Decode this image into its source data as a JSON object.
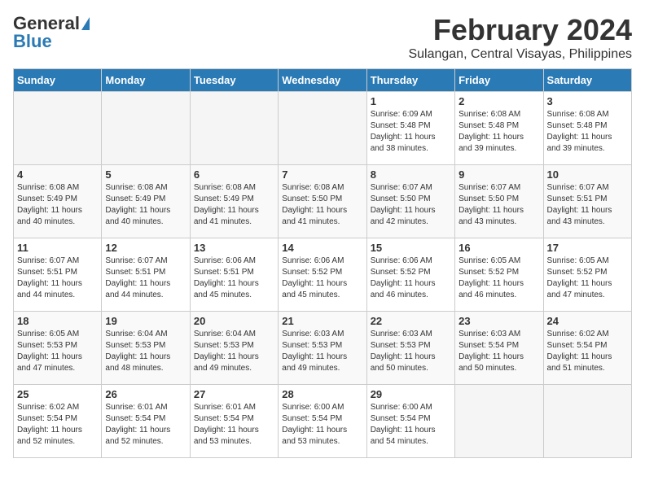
{
  "logo": {
    "general": "General",
    "blue": "Blue"
  },
  "title": "February 2024",
  "subtitle": "Sulangan, Central Visayas, Philippines",
  "days_of_week": [
    "Sunday",
    "Monday",
    "Tuesday",
    "Wednesday",
    "Thursday",
    "Friday",
    "Saturday"
  ],
  "weeks": [
    [
      {
        "day": "",
        "info": ""
      },
      {
        "day": "",
        "info": ""
      },
      {
        "day": "",
        "info": ""
      },
      {
        "day": "",
        "info": ""
      },
      {
        "day": "1",
        "info": "Sunrise: 6:09 AM\nSunset: 5:48 PM\nDaylight: 11 hours\nand 38 minutes."
      },
      {
        "day": "2",
        "info": "Sunrise: 6:08 AM\nSunset: 5:48 PM\nDaylight: 11 hours\nand 39 minutes."
      },
      {
        "day": "3",
        "info": "Sunrise: 6:08 AM\nSunset: 5:48 PM\nDaylight: 11 hours\nand 39 minutes."
      }
    ],
    [
      {
        "day": "4",
        "info": "Sunrise: 6:08 AM\nSunset: 5:49 PM\nDaylight: 11 hours\nand 40 minutes."
      },
      {
        "day": "5",
        "info": "Sunrise: 6:08 AM\nSunset: 5:49 PM\nDaylight: 11 hours\nand 40 minutes."
      },
      {
        "day": "6",
        "info": "Sunrise: 6:08 AM\nSunset: 5:49 PM\nDaylight: 11 hours\nand 41 minutes."
      },
      {
        "day": "7",
        "info": "Sunrise: 6:08 AM\nSunset: 5:50 PM\nDaylight: 11 hours\nand 41 minutes."
      },
      {
        "day": "8",
        "info": "Sunrise: 6:07 AM\nSunset: 5:50 PM\nDaylight: 11 hours\nand 42 minutes."
      },
      {
        "day": "9",
        "info": "Sunrise: 6:07 AM\nSunset: 5:50 PM\nDaylight: 11 hours\nand 43 minutes."
      },
      {
        "day": "10",
        "info": "Sunrise: 6:07 AM\nSunset: 5:51 PM\nDaylight: 11 hours\nand 43 minutes."
      }
    ],
    [
      {
        "day": "11",
        "info": "Sunrise: 6:07 AM\nSunset: 5:51 PM\nDaylight: 11 hours\nand 44 minutes."
      },
      {
        "day": "12",
        "info": "Sunrise: 6:07 AM\nSunset: 5:51 PM\nDaylight: 11 hours\nand 44 minutes."
      },
      {
        "day": "13",
        "info": "Sunrise: 6:06 AM\nSunset: 5:51 PM\nDaylight: 11 hours\nand 45 minutes."
      },
      {
        "day": "14",
        "info": "Sunrise: 6:06 AM\nSunset: 5:52 PM\nDaylight: 11 hours\nand 45 minutes."
      },
      {
        "day": "15",
        "info": "Sunrise: 6:06 AM\nSunset: 5:52 PM\nDaylight: 11 hours\nand 46 minutes."
      },
      {
        "day": "16",
        "info": "Sunrise: 6:05 AM\nSunset: 5:52 PM\nDaylight: 11 hours\nand 46 minutes."
      },
      {
        "day": "17",
        "info": "Sunrise: 6:05 AM\nSunset: 5:52 PM\nDaylight: 11 hours\nand 47 minutes."
      }
    ],
    [
      {
        "day": "18",
        "info": "Sunrise: 6:05 AM\nSunset: 5:53 PM\nDaylight: 11 hours\nand 47 minutes."
      },
      {
        "day": "19",
        "info": "Sunrise: 6:04 AM\nSunset: 5:53 PM\nDaylight: 11 hours\nand 48 minutes."
      },
      {
        "day": "20",
        "info": "Sunrise: 6:04 AM\nSunset: 5:53 PM\nDaylight: 11 hours\nand 49 minutes."
      },
      {
        "day": "21",
        "info": "Sunrise: 6:03 AM\nSunset: 5:53 PM\nDaylight: 11 hours\nand 49 minutes."
      },
      {
        "day": "22",
        "info": "Sunrise: 6:03 AM\nSunset: 5:53 PM\nDaylight: 11 hours\nand 50 minutes."
      },
      {
        "day": "23",
        "info": "Sunrise: 6:03 AM\nSunset: 5:54 PM\nDaylight: 11 hours\nand 50 minutes."
      },
      {
        "day": "24",
        "info": "Sunrise: 6:02 AM\nSunset: 5:54 PM\nDaylight: 11 hours\nand 51 minutes."
      }
    ],
    [
      {
        "day": "25",
        "info": "Sunrise: 6:02 AM\nSunset: 5:54 PM\nDaylight: 11 hours\nand 52 minutes."
      },
      {
        "day": "26",
        "info": "Sunrise: 6:01 AM\nSunset: 5:54 PM\nDaylight: 11 hours\nand 52 minutes."
      },
      {
        "day": "27",
        "info": "Sunrise: 6:01 AM\nSunset: 5:54 PM\nDaylight: 11 hours\nand 53 minutes."
      },
      {
        "day": "28",
        "info": "Sunrise: 6:00 AM\nSunset: 5:54 PM\nDaylight: 11 hours\nand 53 minutes."
      },
      {
        "day": "29",
        "info": "Sunrise: 6:00 AM\nSunset: 5:54 PM\nDaylight: 11 hours\nand 54 minutes."
      },
      {
        "day": "",
        "info": ""
      },
      {
        "day": "",
        "info": ""
      }
    ]
  ]
}
